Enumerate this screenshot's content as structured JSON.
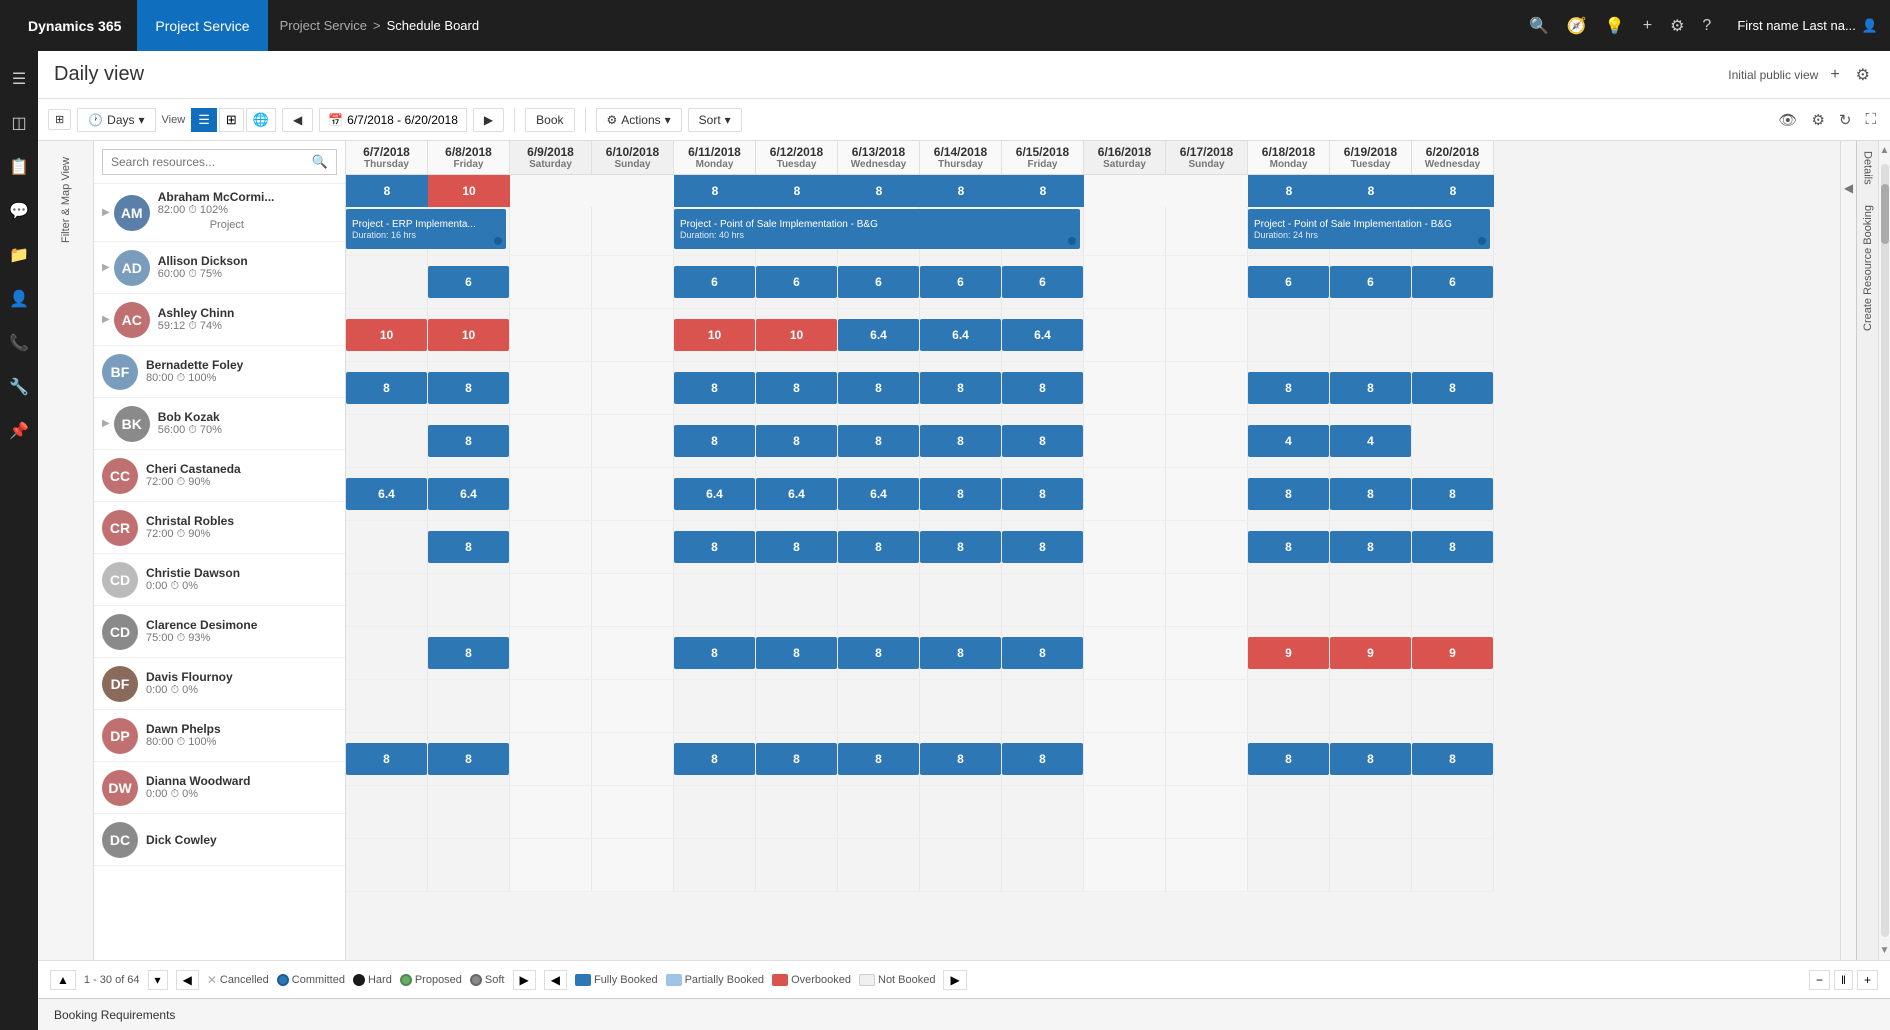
{
  "app": {
    "brand": "Dynamics 365",
    "module": "Project Service",
    "breadcrumb_parent": "Project Service",
    "breadcrumb_separator": ">",
    "breadcrumb_current": "Schedule Board",
    "user": "First name Last na..."
  },
  "header": {
    "title": "Daily view",
    "view_label": "Initial public view",
    "add_icon": "+",
    "settings_icon": "⚙"
  },
  "toolbar": {
    "days_btn": "Days",
    "view_label": "View",
    "date_range": "6/7/2018 - 6/20/2018",
    "book_btn": "Book",
    "actions_btn": "Actions",
    "sort_btn": "Sort"
  },
  "search": {
    "placeholder": "Search resources..."
  },
  "dates": [
    {
      "date": "6/7/2018",
      "day": "Thursday",
      "weekend": false
    },
    {
      "date": "6/8/2018",
      "day": "Friday",
      "weekend": false
    },
    {
      "date": "6/9/2018",
      "day": "Saturday",
      "weekend": true
    },
    {
      "date": "6/10/2018",
      "day": "Sunday",
      "weekend": true
    },
    {
      "date": "6/11/2018",
      "day": "Monday",
      "weekend": false
    },
    {
      "date": "6/12/2018",
      "day": "Tuesday",
      "weekend": false
    },
    {
      "date": "6/13/2018",
      "day": "Wednesday",
      "weekend": false
    },
    {
      "date": "6/14/2018",
      "day": "Thursday",
      "weekend": false
    },
    {
      "date": "6/15/2018",
      "day": "Friday",
      "weekend": false
    },
    {
      "date": "6/16/2018",
      "day": "Saturday",
      "weekend": true
    },
    {
      "date": "6/17/2018",
      "day": "Sunday",
      "weekend": true
    },
    {
      "date": "6/18/2018",
      "day": "Monday",
      "weekend": false
    },
    {
      "date": "6/19/2018",
      "day": "Tuesday",
      "weekend": false
    },
    {
      "date": "6/20/2018",
      "day": "Wednesday",
      "weekend": false
    }
  ],
  "resources": [
    {
      "name": "Abraham McCormi...",
      "hours": "82:00",
      "pct": "102%",
      "sub": "Project",
      "color": "#5a7fa8",
      "bookings": [
        8,
        10,
        null,
        null,
        8,
        8,
        8,
        8,
        8,
        null,
        null,
        8,
        8,
        8
      ],
      "overbooked": [
        false,
        true,
        false,
        false,
        false,
        false,
        false,
        false,
        false,
        false,
        false,
        false,
        false,
        false
      ],
      "projects": [
        {
          "start": 0,
          "span": 2,
          "label": "Project - ERP Implementa...",
          "sub": "Duration: 16 hrs"
        },
        {
          "start": 4,
          "span": 5,
          "label": "Project - Point of Sale Implementation - B&G",
          "sub": "Duration: 40 hrs"
        },
        {
          "start": 11,
          "span": 3,
          "label": "Project - Point of Sale Implementation - B&G",
          "sub": "Duration: 24 hrs"
        }
      ]
    },
    {
      "name": "Allison Dickson",
      "hours": "60:00",
      "pct": "75%",
      "sub": "",
      "color": "#7a9cbd",
      "bookings": [
        null,
        6,
        null,
        null,
        6,
        6,
        6,
        6,
        6,
        null,
        null,
        6,
        6,
        6
      ],
      "overbooked": [
        false,
        false,
        false,
        false,
        false,
        false,
        false,
        false,
        false,
        false,
        false,
        false,
        false,
        false
      ]
    },
    {
      "name": "Ashley Chinn",
      "hours": "59:12",
      "pct": "74%",
      "sub": "",
      "color": "#c07070",
      "bookings": [
        10,
        10,
        null,
        null,
        10,
        10,
        6.4,
        6.4,
        6.4,
        null,
        null,
        null,
        null,
        null
      ],
      "overbooked": [
        true,
        true,
        false,
        false,
        true,
        true,
        false,
        false,
        false,
        false,
        false,
        false,
        false,
        false
      ]
    },
    {
      "name": "Bernadette Foley",
      "hours": "80:00",
      "pct": "100%",
      "sub": "",
      "color": "#7a9cbd",
      "bookings": [
        8,
        8,
        null,
        null,
        8,
        8,
        8,
        8,
        8,
        null,
        null,
        8,
        8,
        8
      ],
      "overbooked": [
        false,
        false,
        false,
        false,
        false,
        false,
        false,
        false,
        false,
        false,
        false,
        false,
        false,
        false
      ]
    },
    {
      "name": "Bob Kozak",
      "hours": "56:00",
      "pct": "70%",
      "sub": "",
      "color": "#8a8a8a",
      "bookings": [
        null,
        8,
        null,
        null,
        8,
        8,
        8,
        8,
        8,
        null,
        null,
        4,
        4,
        null
      ],
      "overbooked": [
        false,
        false,
        false,
        false,
        false,
        false,
        false,
        false,
        false,
        false,
        false,
        false,
        false,
        false
      ]
    },
    {
      "name": "Cheri Castaneda",
      "hours": "72:00",
      "pct": "90%",
      "sub": "",
      "color": "#c07070",
      "bookings": [
        6.4,
        6.4,
        null,
        null,
        6.4,
        6.4,
        6.4,
        8,
        8,
        null,
        null,
        8,
        8,
        8
      ],
      "overbooked": [
        false,
        false,
        false,
        false,
        false,
        false,
        false,
        false,
        false,
        false,
        false,
        false,
        false,
        false
      ]
    },
    {
      "name": "Christal Robles",
      "hours": "72:00",
      "pct": "90%",
      "sub": "",
      "color": "#c07070",
      "bookings": [
        null,
        8,
        null,
        null,
        8,
        8,
        8,
        8,
        8,
        null,
        null,
        8,
        8,
        8
      ],
      "overbooked": [
        false,
        false,
        false,
        false,
        false,
        false,
        false,
        false,
        false,
        false,
        false,
        false,
        false,
        false
      ]
    },
    {
      "name": "Christie Dawson",
      "hours": "0:00",
      "pct": "0%",
      "sub": "",
      "color": "#bbb",
      "bookings": [
        null,
        null,
        null,
        null,
        null,
        null,
        null,
        null,
        null,
        null,
        null,
        null,
        null,
        null
      ],
      "overbooked": [
        false,
        false,
        false,
        false,
        false,
        false,
        false,
        false,
        false,
        false,
        false,
        false,
        false,
        false
      ]
    },
    {
      "name": "Clarence Desimone",
      "hours": "75:00",
      "pct": "93%",
      "sub": "",
      "color": "#8a8a8a",
      "bookings": [
        null,
        8,
        null,
        null,
        8,
        8,
        8,
        8,
        8,
        null,
        null,
        9,
        9,
        9
      ],
      "overbooked": [
        false,
        false,
        false,
        false,
        false,
        false,
        false,
        false,
        false,
        false,
        false,
        true,
        true,
        true
      ]
    },
    {
      "name": "Davis Flournoy",
      "hours": "0:00",
      "pct": "0%",
      "sub": "",
      "color": "#8a6a5a",
      "bookings": [
        null,
        null,
        null,
        null,
        null,
        null,
        null,
        null,
        null,
        null,
        null,
        null,
        null,
        null
      ],
      "overbooked": [
        false,
        false,
        false,
        false,
        false,
        false,
        false,
        false,
        false,
        false,
        false,
        false,
        false,
        false
      ]
    },
    {
      "name": "Dawn Phelps",
      "hours": "80:00",
      "pct": "100%",
      "sub": "",
      "color": "#c07070",
      "bookings": [
        8,
        8,
        null,
        null,
        8,
        8,
        8,
        8,
        8,
        null,
        null,
        8,
        8,
        8
      ],
      "overbooked": [
        false,
        false,
        false,
        false,
        false,
        false,
        false,
        false,
        false,
        false,
        false,
        false,
        false,
        false
      ]
    },
    {
      "name": "Dianna Woodward",
      "hours": "0:00",
      "pct": "0%",
      "sub": "",
      "color": "#c07070",
      "bookings": [
        null,
        null,
        null,
        null,
        null,
        null,
        null,
        null,
        null,
        null,
        null,
        null,
        null,
        null
      ],
      "overbooked": [
        false,
        false,
        false,
        false,
        false,
        false,
        false,
        false,
        false,
        false,
        false,
        false,
        false,
        false
      ]
    },
    {
      "name": "Dick Cowley",
      "hours": "",
      "pct": "",
      "sub": "",
      "color": "#8a8a8a",
      "bookings": [
        null,
        null,
        null,
        null,
        null,
        null,
        null,
        null,
        null,
        null,
        null,
        null,
        null,
        null
      ],
      "overbooked": [
        false,
        false,
        false,
        false,
        false,
        false,
        false,
        false,
        false,
        false,
        false,
        false,
        false,
        false
      ]
    }
  ],
  "legend": {
    "cancelled_label": "Cancelled",
    "committed_label": "Committed",
    "hard_label": "Hard",
    "proposed_label": "Proposed",
    "soft_label": "Soft",
    "fully_booked_label": "Fully Booked",
    "partially_booked_label": "Partially Booked",
    "overbooked_label": "Overbooked",
    "not_booked_label": "Not Booked"
  },
  "pagination": {
    "range": "1 - 30 of 64"
  },
  "bottom_bar": {
    "label": "Booking Requirements"
  },
  "sidebar": {
    "items": [
      "☰",
      "📊",
      "📋",
      "💬",
      "📁",
      "👤",
      "📞",
      "🔧",
      "📌"
    ]
  },
  "right_panel": {
    "details_label": "Details",
    "create_label": "Create Resource Booking"
  }
}
